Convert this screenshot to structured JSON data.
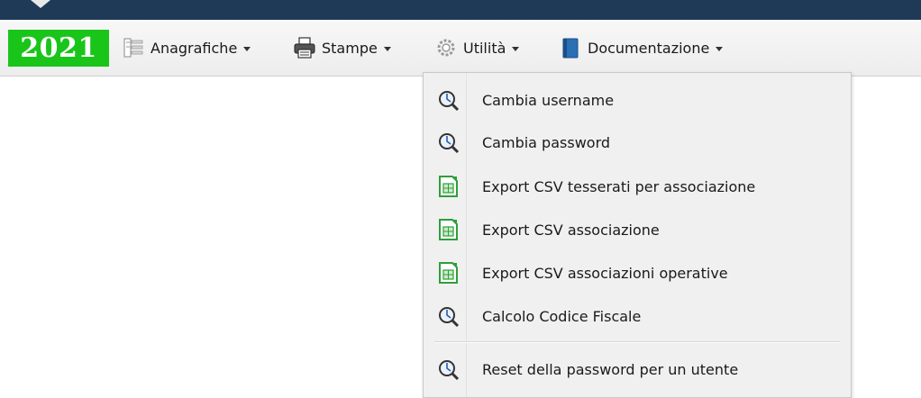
{
  "year": "2021",
  "menubar": {
    "items": [
      {
        "label": "Anagrafiche",
        "icon": "registry-list-icon"
      },
      {
        "label": "Stampe",
        "icon": "printer-icon"
      },
      {
        "label": "Utilità",
        "icon": "gears-icon"
      },
      {
        "label": "Documentazione",
        "icon": "book-icon"
      }
    ]
  },
  "dropdown": {
    "parent": "Utilità",
    "items": [
      {
        "label": "Cambia username",
        "icon": "magnifier-icon"
      },
      {
        "label": "Cambia password",
        "icon": "magnifier-icon"
      },
      {
        "label": "Export CSV tesserati per associazione",
        "icon": "spreadsheet-icon"
      },
      {
        "label": "Export CSV associazione",
        "icon": "spreadsheet-icon"
      },
      {
        "label": "Export CSV associazioni operative",
        "icon": "spreadsheet-icon"
      },
      {
        "label": "Calcolo Codice Fiscale",
        "icon": "magnifier-icon"
      },
      {
        "label": "Reset della password per un utente",
        "icon": "magnifier-icon"
      }
    ]
  },
  "colors": {
    "top_bar": "#1f3a56",
    "year_badge": "#1ac51a",
    "spreadsheet_green": "#2f9e3a"
  }
}
